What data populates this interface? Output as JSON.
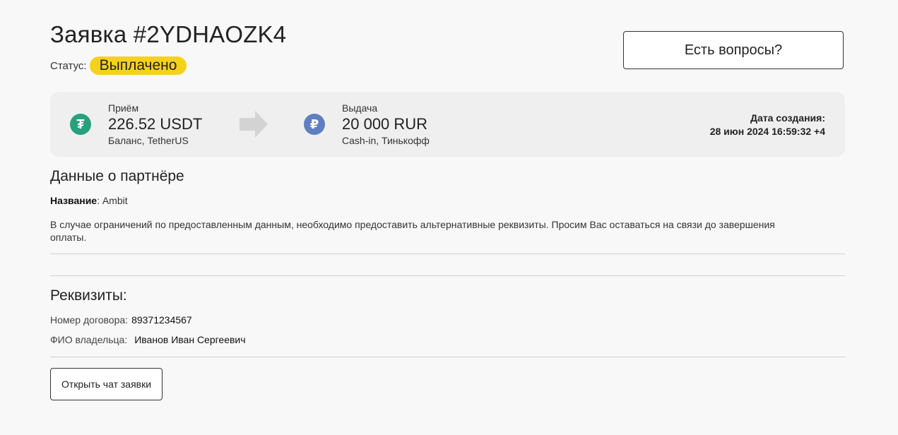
{
  "order": {
    "title": "Заявка #2YDHAOZK4",
    "status_label": "Статус:",
    "status_value": "Выплачено",
    "status_color": "#f5d21a"
  },
  "questions_button": "Есть вопросы?",
  "exchange": {
    "in": {
      "label": "Приём",
      "amount": "226.52 USDT",
      "method": "Баланс, TetherUS",
      "icon": "tether-icon",
      "icon_color": "#26a17b",
      "icon_glyph": "₮"
    },
    "out": {
      "label": "Выдача",
      "amount": "20 000 RUR",
      "method": "Cash-in, Тинькофф",
      "icon": "ruble-icon",
      "icon_color": "#5f7fc0",
      "icon_glyph": "₽"
    },
    "arrow_icon": "arrow-right-icon",
    "created_label": "Дата создания:",
    "created_value": "28 июн 2024 16:59:32 +4"
  },
  "partner": {
    "heading": "Данные о партнёре",
    "name_label": "Название",
    "name_value": ": Ambit",
    "notice": "В случае ограничений по предоставленным данным, необходимо предоставить альтернативные реквизиты. Просим Вас оставаться на связи до завершения оплаты."
  },
  "requisites": {
    "heading": "Реквизиты:",
    "contract_label": "Номер договора:",
    "contract_value": "89371234567",
    "owner_label": "ФИО владельца:",
    "owner_value": "Иванов Иван Сергеевич"
  },
  "chat_button": "Открыть чат заявки"
}
